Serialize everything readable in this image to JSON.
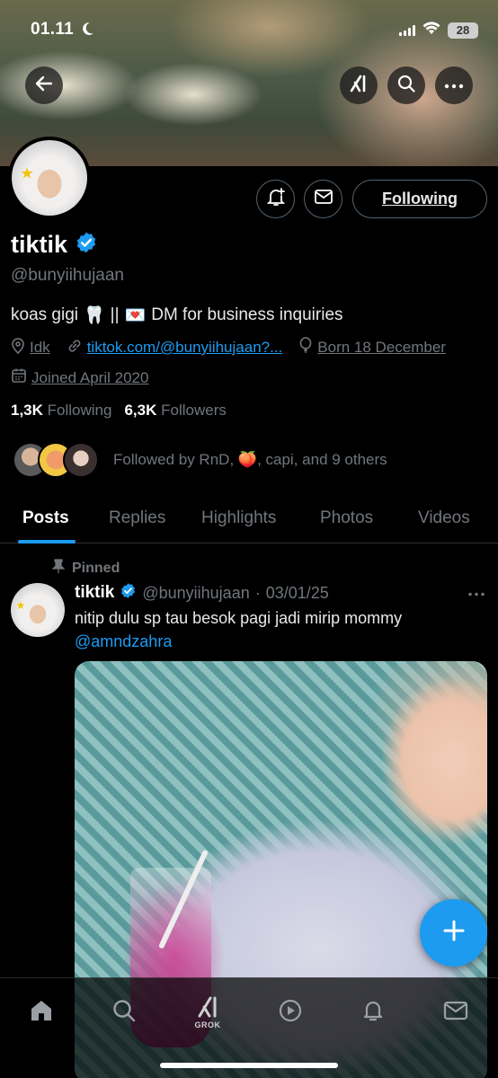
{
  "status_bar": {
    "time": "01.11",
    "battery": "28"
  },
  "header": {
    "back_icon": "arrow-left-icon",
    "grok_icon": "grok-icon",
    "search_icon": "search-icon",
    "more_icon": "more-horizontal-icon"
  },
  "profile": {
    "name": "tiktik",
    "verified": true,
    "handle": "@bunyiihujaan",
    "bio": {
      "prefix": "koas gigi",
      "tooth_emoji": "🦷",
      "separator": "||",
      "love_emoji": "💌",
      "suffix": "DM for business inquiries"
    },
    "location": "Idk",
    "website": "tiktok.com/@bunyiihujaan?...",
    "birthday": "Born 18 December",
    "joined": "Joined April 2020",
    "following_count": "1,3K",
    "following_label": "Following",
    "followers_count": "6,3K",
    "followers_label": "Followers",
    "followed_by": {
      "prefix": "Followed by RnD,",
      "emoji": "🍑",
      "suffix": ", capi, and 9 others"
    }
  },
  "actions": {
    "notify_icon": "bell-plus-icon",
    "message_icon": "mail-icon",
    "following_button": "Following"
  },
  "tabs": [
    {
      "label": "Posts",
      "active": true
    },
    {
      "label": "Replies",
      "active": false
    },
    {
      "label": "Highlights",
      "active": false
    },
    {
      "label": "Photos",
      "active": false
    },
    {
      "label": "Videos",
      "active": false
    }
  ],
  "pinned_post": {
    "pinned_label": "Pinned",
    "author_name": "tiktik",
    "author_handle": "@bunyiihujaan",
    "date_sep": "·",
    "date": "03/01/25",
    "text": "nitip dulu sp tau besok pagi jadi mirip mommy",
    "mention": "@amndzahra"
  },
  "bottom_nav": [
    {
      "icon": "home-icon",
      "label": ""
    },
    {
      "icon": "search-icon",
      "label": ""
    },
    {
      "icon": "grok-icon",
      "label": "GROK"
    },
    {
      "icon": "play-circle-icon",
      "label": ""
    },
    {
      "icon": "bell-icon",
      "label": ""
    },
    {
      "icon": "mail-icon",
      "label": ""
    }
  ],
  "colors": {
    "accent": "#1d9bf0",
    "background": "#000000",
    "secondary_text": "#71767b",
    "primary_text": "#e7e9ea"
  }
}
